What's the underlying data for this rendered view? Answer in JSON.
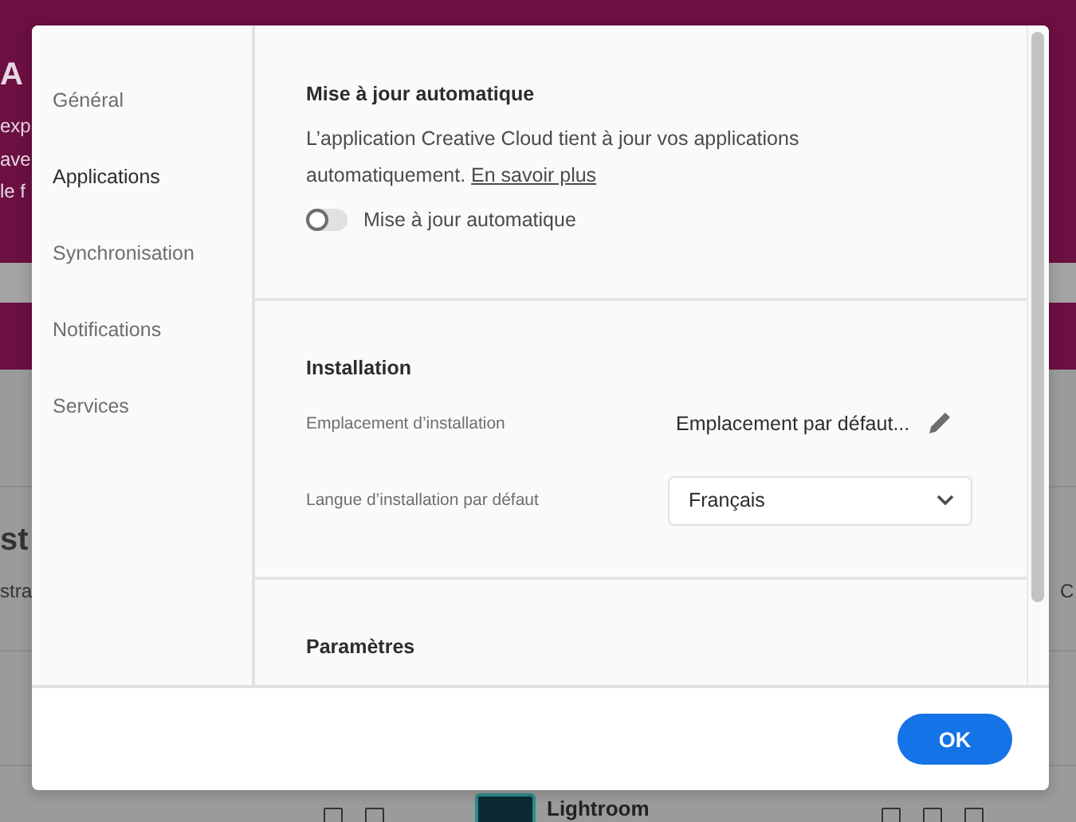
{
  "background": {
    "fragments": [
      {
        "text": "A",
        "kind": "title"
      },
      {
        "text": "exp",
        "kind": "body"
      },
      {
        "text": "ave",
        "kind": "body"
      },
      {
        "text": "le f",
        "kind": "body"
      },
      {
        "text": "st",
        "kind": "title"
      },
      {
        "text": "stra",
        "kind": "body"
      },
      {
        "text": "C",
        "kind": "body"
      }
    ],
    "app_tile": {
      "name": "Lightroom"
    }
  },
  "dialog": {
    "sidebar": {
      "items": [
        {
          "label": "Général",
          "selected": false
        },
        {
          "label": "Applications",
          "selected": true
        },
        {
          "label": "Synchronisation",
          "selected": false
        },
        {
          "label": "Notifications",
          "selected": false
        },
        {
          "label": "Services",
          "selected": false
        }
      ]
    },
    "sections": [
      {
        "title": "Mise à jour automatique",
        "description": "L’application Creative Cloud tient à jour vos applications automatiquement.",
        "link": "En savoir plus",
        "toggle": {
          "label": "Mise à jour automatique",
          "on": false
        }
      },
      {
        "title": "Installation",
        "rows": [
          {
            "kind": "path",
            "label": "Emplacement d’installation",
            "value": "Emplacement par défaut..."
          },
          {
            "kind": "select",
            "label": "Langue d’installation par défaut",
            "value": "Français"
          }
        ]
      },
      {
        "title": "Paramètres"
      }
    ],
    "ok_button": "OK"
  }
}
